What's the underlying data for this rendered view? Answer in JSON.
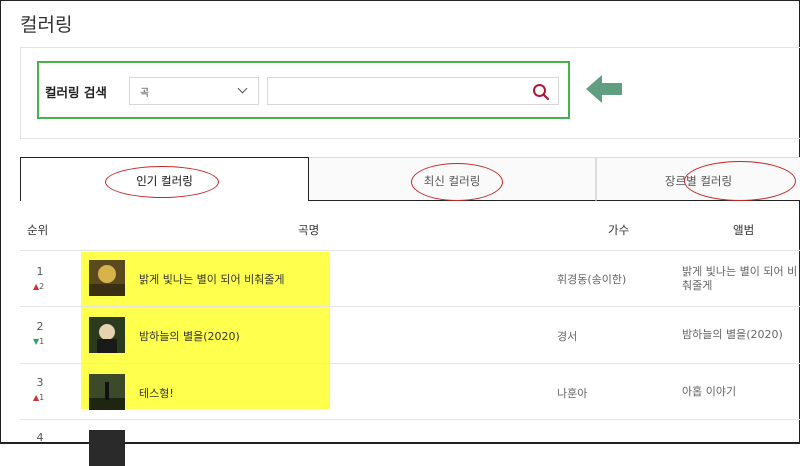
{
  "page": {
    "title": "컬러링"
  },
  "search": {
    "label": "컬러링 검색",
    "select_value": "곡",
    "input_value": "",
    "placeholder": ""
  },
  "tabs": [
    {
      "label": "인기 컬러링",
      "active": true
    },
    {
      "label": "최신 컬러링",
      "active": false
    },
    {
      "label": "장르별 컬러링",
      "active": false
    }
  ],
  "table": {
    "headers": {
      "rank": "순위",
      "song": "곡명",
      "artist": "가수",
      "album": "앨범"
    },
    "rows": [
      {
        "rank": "1",
        "change_icon": "up-arrow",
        "change": "2",
        "song": "밝게 빛나는 별이 되어 비춰줄게",
        "artist": "휘경동(송이한)",
        "album": "밝게 빛나는 별이 되어 비춰줄게"
      },
      {
        "rank": "2",
        "change_icon": "down-arrow",
        "change": "1",
        "song": "밤하늘의 별을(2020)",
        "artist": "경서",
        "album": "밤하늘의 별을(2020)"
      },
      {
        "rank": "3",
        "change_icon": "up-arrow",
        "change": "1",
        "song": "테스형!",
        "artist": "나훈아",
        "album": "아홉 이야기"
      },
      {
        "rank": "4",
        "change_icon": "",
        "change": "",
        "song": "",
        "artist": "",
        "album": ""
      }
    ]
  },
  "colors": {
    "search_outline": "#4caf50",
    "hint_arrow": "#5f9e80",
    "annotation_oval": "#c62828",
    "highlight": "#ffff4d",
    "rank_up": "#d32f2f",
    "rank_down": "#2e9e6b"
  }
}
